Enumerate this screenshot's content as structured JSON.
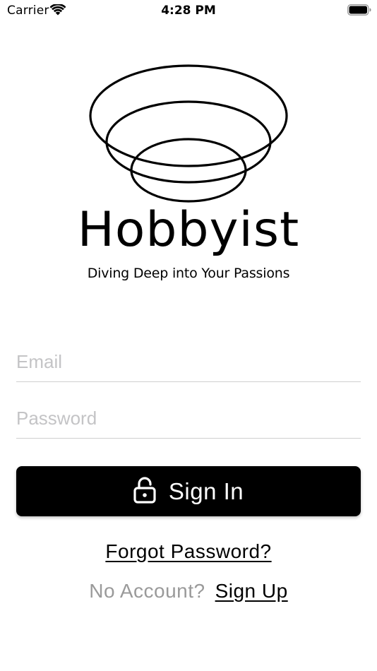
{
  "status_bar": {
    "carrier": "Carrier",
    "time": "4:28 PM",
    "wifi_icon": "wifi-icon",
    "battery_icon": "battery-icon"
  },
  "logo": {
    "icon": "bowl-logo-icon",
    "name": "Hobbyist",
    "tagline": "Diving Deep into Your Passions"
  },
  "form": {
    "email_placeholder": "Email",
    "email_value": "",
    "password_placeholder": "Password",
    "password_value": ""
  },
  "actions": {
    "sign_in_label": "Sign In",
    "sign_in_icon": "lock-icon",
    "forgot_password_label": "Forgot Password?",
    "no_account_label": "No Account?",
    "sign_up_label": "Sign Up"
  },
  "colors": {
    "primary": "#000000",
    "background": "#ffffff",
    "placeholder": "#c4c4c6",
    "muted_text": "#9a9a9a",
    "divider": "#cfcfcf"
  }
}
